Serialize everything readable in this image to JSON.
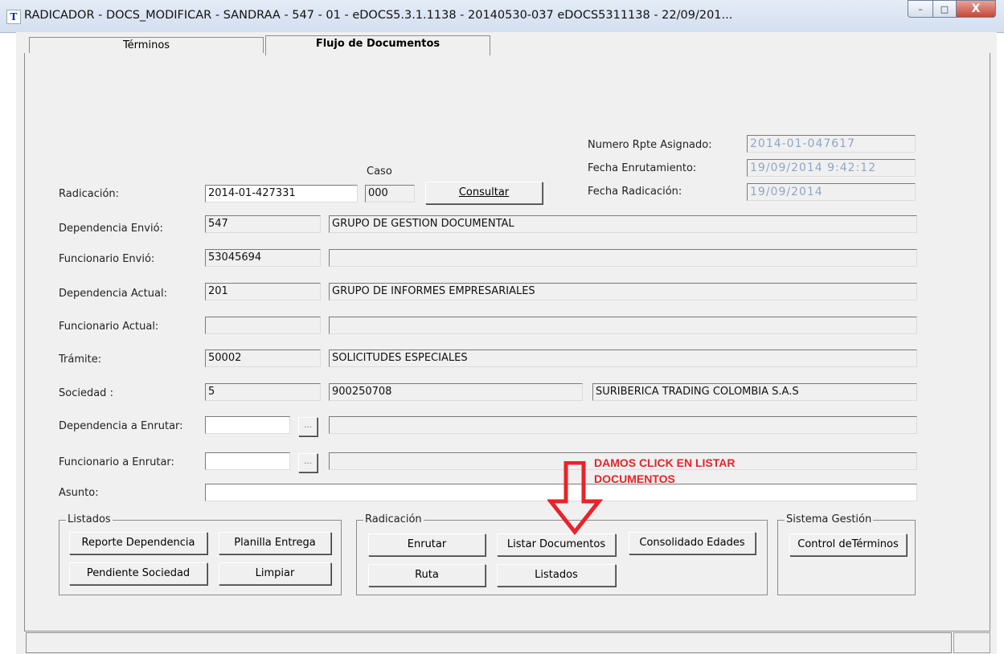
{
  "window": {
    "title": "RADICADOR - DOCS_MODIFICAR - SANDRAA - 547 - 01 - eDOCS5.3.1.1138 - 20140530-037 eDOCS5311138 - 22/09/201...",
    "icon_name": "app-logo-icon",
    "controls": {
      "minimize": "–",
      "maximize": "□",
      "close": "X"
    }
  },
  "tabs": [
    {
      "label": "Términos",
      "active": false
    },
    {
      "label": "Flujo de Documentos",
      "active": true
    }
  ],
  "info": {
    "numero_rpte_label": "Numero Rpte Asignado:",
    "numero_rpte_value": "2014-01-047617",
    "fecha_enrutamiento_label": "Fecha Enrutamiento:",
    "fecha_enrutamiento_value": "19/09/2014 9:42:12",
    "fecha_radicacion_label": "Fecha Radicación:",
    "fecha_radicacion_value": "19/09/2014"
  },
  "form": {
    "caso_label": "Caso",
    "radicacion_label": "Radicación:",
    "radicacion_value": "2014-01-427331",
    "caso_value": "000",
    "consultar_label": "Consultar",
    "dependencia_envio_label": "Dependencia Envió:",
    "dependencia_envio_code": "547",
    "dependencia_envio_name": "GRUPO DE GESTION DOCUMENTAL",
    "funcionario_envio_label": "Funcionario Envió:",
    "funcionario_envio_code": "53045694",
    "funcionario_envio_name": "",
    "dependencia_actual_label": "Dependencia Actual:",
    "dependencia_actual_code": "201",
    "dependencia_actual_name": "GRUPO DE INFORMES EMPRESARIALES",
    "funcionario_actual_label": "Funcionario Actual:",
    "funcionario_actual_code": "",
    "funcionario_actual_name": "",
    "tramite_label": "Trámite:",
    "tramite_code": "50002",
    "tramite_name": "SOLICITUDES ESPECIALES",
    "sociedad_label": "Sociedad :",
    "sociedad_code": "5",
    "sociedad_nit": "900250708",
    "sociedad_name": "SURIBERICA TRADING COLOMBIA S.A.S",
    "dependencia_enrutar_label": "Dependencia a Enrutar:",
    "dependencia_enrutar_code": "",
    "dependencia_enrutar_name": "",
    "funcionario_enrutar_label": "Funcionario a Enrutar:",
    "funcionario_enrutar_code": "",
    "funcionario_enrutar_name": "",
    "ellipsis_label": "...",
    "asunto_label": "Asunto:",
    "asunto_value": ""
  },
  "groups": {
    "listados": {
      "title": "Listados",
      "reporte_dependencia": "Reporte Dependencia",
      "planilla_entrega": "Planilla Entrega",
      "pendiente_sociedad": "Pendiente Sociedad",
      "limpiar": "Limpiar"
    },
    "radicacion": {
      "title": "Radicación",
      "enrutar": "Enrutar",
      "listar_documentos": "Listar Documentos",
      "consolidado_edades": "Consolidado Edades",
      "ruta": "Ruta",
      "listados": "Listados"
    },
    "sistema_gestion": {
      "title": "Sistema Gestión",
      "control_terminos": "Control deTérminos"
    }
  },
  "annotation": {
    "line1": "DAMOS CLICK EN LISTAR",
    "line2": "DOCUMENTOS",
    "color": "#e8232a"
  }
}
